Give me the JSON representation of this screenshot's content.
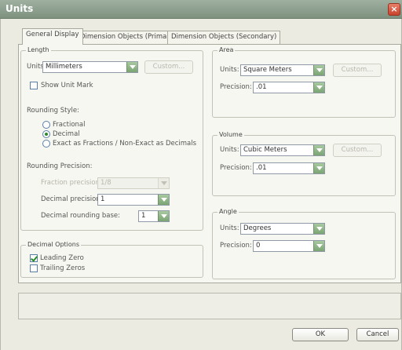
{
  "window": {
    "title": "Units"
  },
  "tabs": [
    {
      "label": "General Display",
      "active": true
    },
    {
      "label": "Dimension Objects (Primary)",
      "active": false
    },
    {
      "label": "Dimension Objects (Secondary)",
      "active": false
    }
  ],
  "length": {
    "group_label": "Length",
    "units_label": "Units:",
    "units_value": "Millimeters",
    "custom_label": "Custom...",
    "show_unit_mark": "Show Unit Mark",
    "show_unit_mark_checked": false,
    "rounding_style_label": "Rounding Style:",
    "rounding_options": [
      {
        "label": "Fractional",
        "checked": false
      },
      {
        "label": "Decimal",
        "checked": true
      },
      {
        "label": "Exact as Fractions / Non-Exact as Decimals",
        "checked": false
      }
    ],
    "rounding_precision_label": "Rounding Precision:",
    "fraction_precision_label": "Fraction precision:",
    "fraction_precision_value": "1/8",
    "decimal_precision_label": "Decimal precision:",
    "decimal_precision_value": "1",
    "decimal_rounding_base_label": "Decimal rounding base:",
    "decimal_rounding_base_value": "1"
  },
  "decimal_options": {
    "group_label": "Decimal Options",
    "leading_zero": "Leading Zero",
    "leading_zero_checked": true,
    "trailing_zeros": "Trailing Zeros",
    "trailing_zeros_checked": false
  },
  "area": {
    "group_label": "Area",
    "units_label": "Units:",
    "units_value": "Square Meters",
    "custom_label": "Custom...",
    "precision_label": "Precision:",
    "precision_value": ".01"
  },
  "volume": {
    "group_label": "Volume",
    "units_label": "Units:",
    "units_value": "Cubic Meters",
    "custom_label": "Custom...",
    "precision_label": "Precision:",
    "precision_value": ".01"
  },
  "angle": {
    "group_label": "Angle",
    "units_label": "Units:",
    "units_value": "Degrees",
    "precision_label": "Precision:",
    "precision_value": "0"
  },
  "buttons": {
    "ok": "OK",
    "cancel": "Cancel"
  },
  "colors": {
    "titlebar": "#8fa190",
    "accent_green": "#7aa472",
    "close_red": "#c8442c",
    "dialog_bg": "#ecebe2"
  }
}
